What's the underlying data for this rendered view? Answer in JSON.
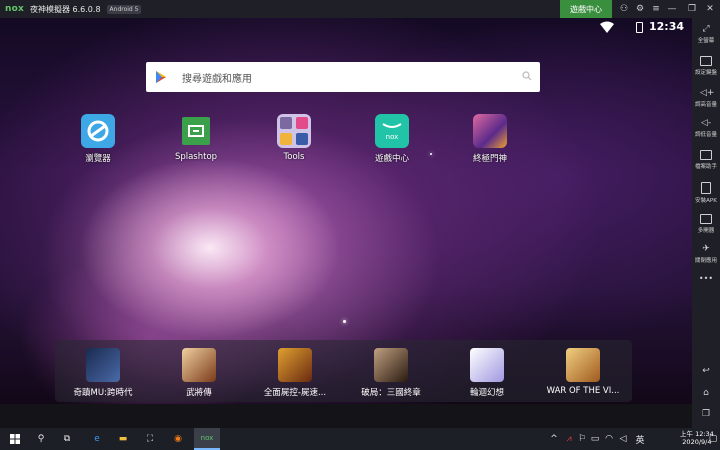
{
  "window": {
    "logo": "nox",
    "title": "夜神模擬器 6.6.0.8",
    "android_badge": "Android 5",
    "game_center": "遊戲中心"
  },
  "status": {
    "time": "12:34"
  },
  "search": {
    "placeholder": "搜尋遊戲和應用"
  },
  "apps": [
    {
      "label": "瀏覽器",
      "color": "#3ea8e6"
    },
    {
      "label": "Splashtop",
      "color": "#3aa04a"
    },
    {
      "label": "Tools",
      "color": "#cfc4e8"
    },
    {
      "label": "遊戲中心",
      "color": "#22c4a8"
    },
    {
      "label": "終極門神",
      "color": "#6a3a9a"
    }
  ],
  "dock": [
    {
      "label": "奇蹟MU:跨時代",
      "color": "#2a3d6a"
    },
    {
      "label": "武將傳",
      "color": "#7a4a2a"
    },
    {
      "label": "全面屍控-屍速...",
      "color": "#8a5a1a"
    },
    {
      "label": "破局：三國終章",
      "color": "#4a3a2a"
    },
    {
      "label": "輪迴幻想",
      "color": "#b8b0e0"
    },
    {
      "label": "WAR OF THE VI...",
      "color": "#c89a4a"
    }
  ],
  "sidebar": [
    {
      "label": "全螢幕",
      "icon": "fullscreen-icon"
    },
    {
      "label": "設定鍵盤",
      "icon": "keyboard-icon"
    },
    {
      "label": "調高音量",
      "icon": "volume-up-icon"
    },
    {
      "label": "調低音量",
      "icon": "volume-down-icon"
    },
    {
      "label": "檔案助手",
      "icon": "file-assistant-icon"
    },
    {
      "label": "安裝APK",
      "icon": "apk-icon"
    },
    {
      "label": "多開器",
      "icon": "multi-instance-icon"
    },
    {
      "label": "關閉應用",
      "icon": "close-app-icon"
    }
  ],
  "sidebar_more": "•••",
  "tray": {
    "ime": "英",
    "time": "上午 12:34",
    "date": "2020/9/4"
  }
}
